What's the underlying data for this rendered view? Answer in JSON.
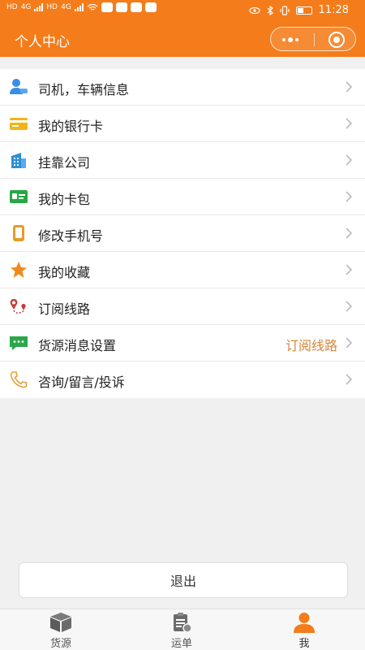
{
  "status_bar": {
    "left_labels": [
      "HD",
      "4G",
      "HD",
      "4G"
    ],
    "time": "11:28"
  },
  "header": {
    "title": "个人中心"
  },
  "menu": {
    "items": [
      {
        "label": "司机，车辆信息",
        "icon": "driver-icon",
        "color": "#3a8ee6"
      },
      {
        "label": "我的银行卡",
        "icon": "bank-card-icon",
        "color": "#f3b416"
      },
      {
        "label": "挂靠公司",
        "icon": "building-icon",
        "color": "#2c8fd6"
      },
      {
        "label": "我的卡包",
        "icon": "card-wallet-icon",
        "color": "#27a845"
      },
      {
        "label": "修改手机号",
        "icon": "phone-icon",
        "color": "#e69a2a"
      },
      {
        "label": "我的收藏",
        "icon": "star-icon",
        "color": "#f08a1c"
      },
      {
        "label": "订阅线路",
        "icon": "route-icon",
        "color": "#c73b3b"
      },
      {
        "label": "货源消息设置",
        "icon": "message-icon",
        "color": "#2aa84a",
        "value": "订阅线路"
      },
      {
        "label": "咨询/留言/投诉",
        "icon": "phone-call-icon",
        "color": "#e2a23a"
      }
    ]
  },
  "logout": {
    "label": "退出"
  },
  "tabbar": {
    "tabs": [
      {
        "label": "货源",
        "icon": "box-icon"
      },
      {
        "label": "运单",
        "icon": "waybill-icon"
      },
      {
        "label": "我",
        "icon": "user-icon",
        "active": true
      }
    ],
    "active_color": "#f47c1a"
  }
}
